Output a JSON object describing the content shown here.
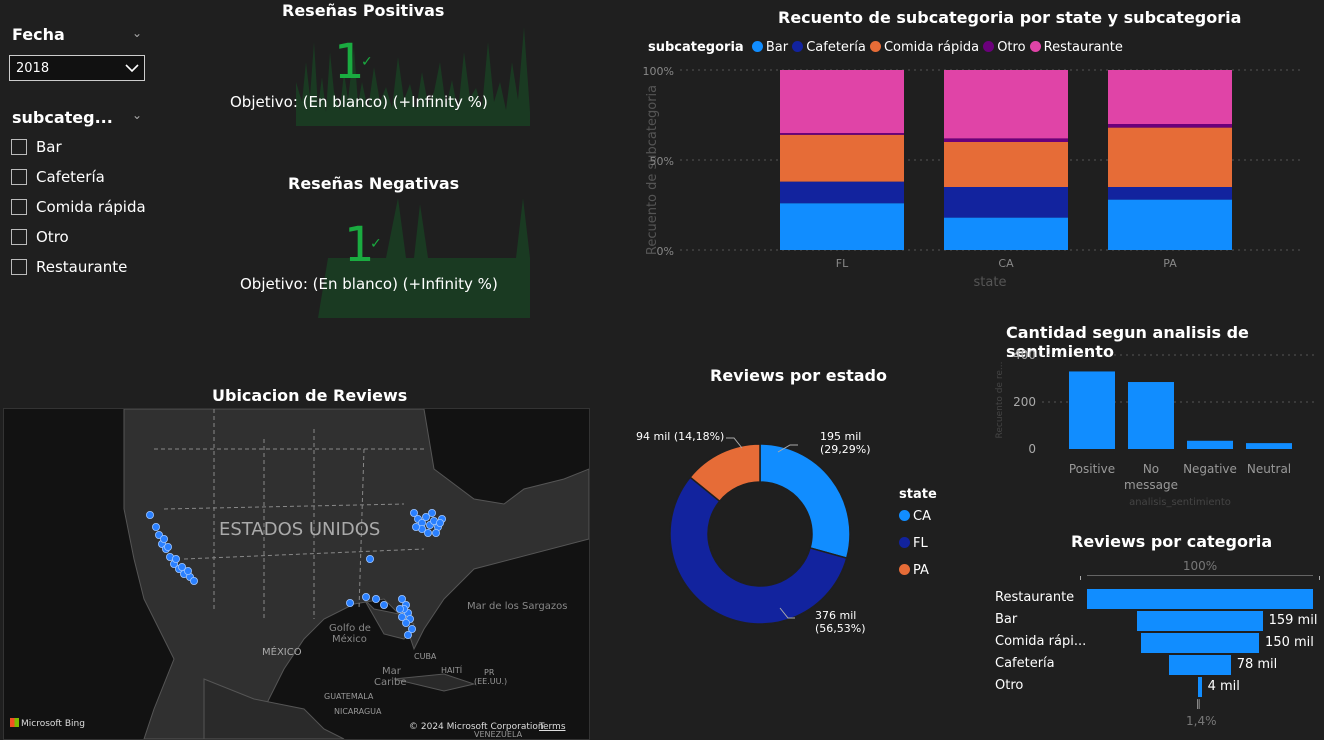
{
  "filters": {
    "fecha": {
      "label": "Fecha",
      "selected": "2018"
    },
    "subcategoria": {
      "label": "subcateg...",
      "options": [
        "Bar",
        "Cafetería",
        "Comida rápida",
        "Otro",
        "Restaurante"
      ]
    }
  },
  "kpis": [
    {
      "title": "Reseñas Positivas",
      "value": "1",
      "target": "Objetivo: (En blanco) (+Infinity %)"
    },
    {
      "title": "Reseñas Negativas",
      "value": "1",
      "target": "Objetivo: (En blanco) (+Infinity %)"
    }
  ],
  "stacked": {
    "title": "Recuento de subcategoria por state y subcategoria",
    "legend_title": "subcategoria",
    "ylabel": "Recuento de subcategoria",
    "xlabel": "state",
    "yticks": [
      "100%",
      "50%",
      "0%"
    ]
  },
  "map": {
    "title": "Ubicacion de Reviews",
    "country_label": "ESTADOS UNIDOS",
    "credit": "Microsoft Bing",
    "copyright": "© 2024 Microsoft Corporation",
    "terms": "Terms",
    "place_labels": [
      "Golfo de\nMéxico",
      "MÉXICO",
      "Mar de los Sargazos",
      "Mar\nCaribe",
      "CUBA",
      "HAITÍ",
      "PR\n(EE.UU.)",
      "GUATEMALA",
      "NICARAGUA",
      "VENEZUELA"
    ]
  },
  "donut": {
    "title": "Reviews por estado",
    "legend_title": "state",
    "labels": {
      "CA": "195 mil (29,29%)",
      "FL": "376 mil (56,53%)",
      "PA": "94 mil (14,18%)"
    }
  },
  "sentiment": {
    "title": "Cantidad segun analisis de sentimiento",
    "ylabel": "Recuento de re...",
    "xlabel": "analisis_sentimiento",
    "yticks": [
      "400",
      "200",
      "0"
    ]
  },
  "funnel": {
    "title": "Reviews por categoria",
    "top_pct": "100%",
    "bottom_pct": "1,4%",
    "labels": [
      "Restaurante",
      "Bar",
      "Comida rápi...",
      "Cafetería",
      "Otro"
    ],
    "value_labels": [
      "",
      "159 mil",
      "150 mil",
      "78 mil",
      "4 mil"
    ]
  },
  "colors": {
    "bar": "#118DFF",
    "cafeteria": "#12239E",
    "comida": "#E66C37",
    "otro": "#6B007B",
    "restaurante": "#E044A7",
    "kpi_green": "#1AAB40"
  },
  "chart_data": [
    {
      "type": "bar",
      "title": "Recuento de subcategoria por state y subcategoria",
      "xlabel": "state",
      "ylabel": "Recuento de subcategoria",
      "categories": [
        "FL",
        "CA",
        "PA"
      ],
      "stacked": true,
      "normalized": true,
      "ylim": [
        0,
        100
      ],
      "series": [
        {
          "name": "Bar",
          "values": [
            26,
            18,
            28
          ]
        },
        {
          "name": "Cafetería",
          "values": [
            12,
            17,
            7
          ]
        },
        {
          "name": "Comida rápida",
          "values": [
            26,
            25,
            33
          ]
        },
        {
          "name": "Otro",
          "values": [
            1,
            2,
            2
          ]
        },
        {
          "name": "Restaurante",
          "values": [
            35,
            38,
            30
          ]
        }
      ],
      "legend": "top-left"
    },
    {
      "type": "pie",
      "title": "Reviews por estado",
      "categories": [
        "CA",
        "FL",
        "PA"
      ],
      "values": [
        195,
        376,
        94
      ],
      "donut": true,
      "legend": "right"
    },
    {
      "type": "bar",
      "title": "Cantidad segun analisis de sentimiento",
      "xlabel": "analisis_sentimiento",
      "ylabel": "Recuento de re...",
      "categories": [
        "Positive",
        "No message",
        "Negative",
        "Neutral"
      ],
      "values": [
        330,
        285,
        35,
        25
      ],
      "ylim": [
        0,
        400
      ]
    },
    {
      "type": "bar",
      "title": "Reviews por categoria",
      "orientation": "funnel",
      "categories": [
        "Restaurante",
        "Bar",
        "Comida rápi...",
        "Cafetería",
        "Otro"
      ],
      "values": [
        287,
        159,
        150,
        78,
        4
      ]
    }
  ]
}
